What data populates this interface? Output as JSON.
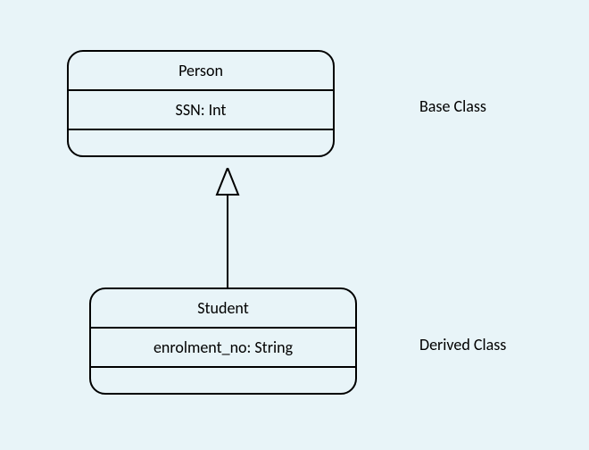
{
  "baseClass": {
    "name": "Person",
    "attribute": "SSN: Int",
    "label": "Base Class"
  },
  "derivedClass": {
    "name": "Student",
    "attribute": "enrolment_no: String",
    "label": "Derived Class"
  }
}
